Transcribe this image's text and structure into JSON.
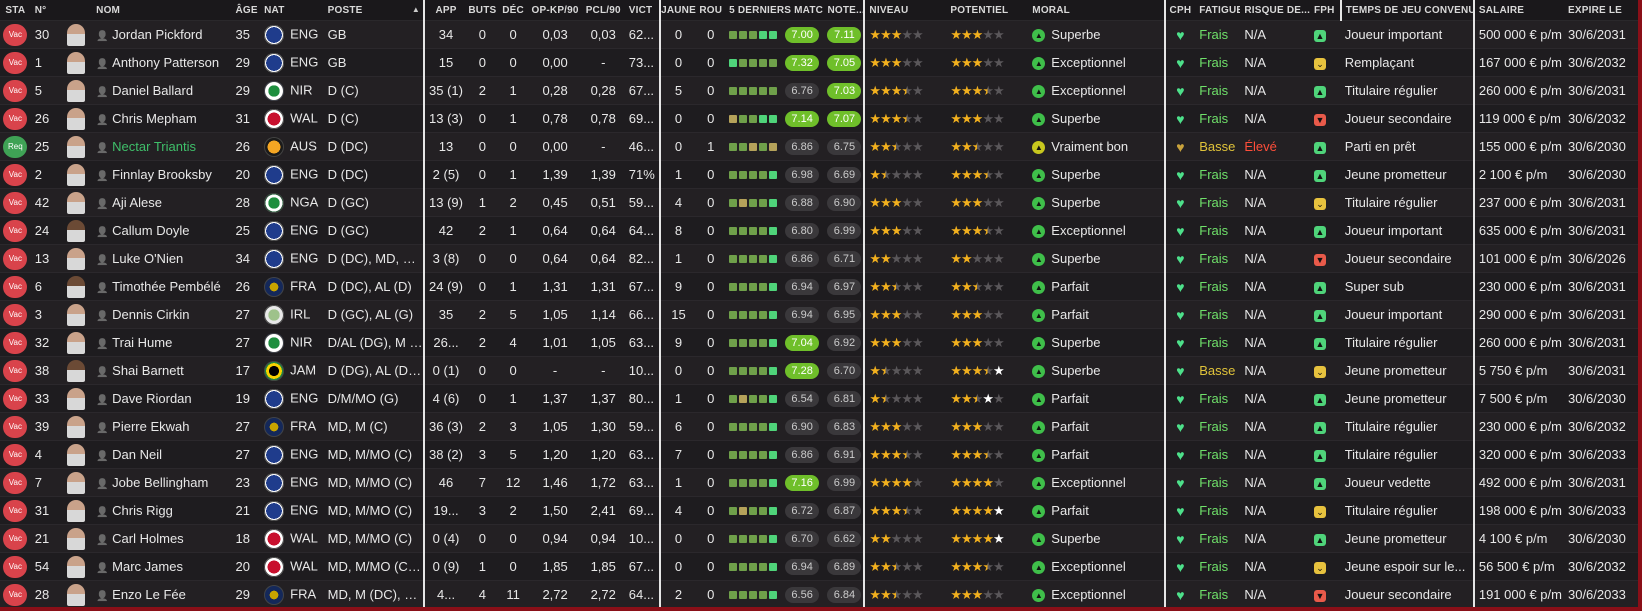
{
  "columns": [
    {
      "key": "sta",
      "label": "STA"
    },
    {
      "key": "num",
      "label": "N°"
    },
    {
      "key": "photo",
      "label": ""
    },
    {
      "key": "name",
      "label": "NOM"
    },
    {
      "key": "age",
      "label": "ÂGE"
    },
    {
      "key": "nat",
      "label": "NAT"
    },
    {
      "key": "pos",
      "label": "POSTE"
    },
    {
      "key": "app",
      "label": "APP"
    },
    {
      "key": "buts",
      "label": "BUTS"
    },
    {
      "key": "dec",
      "label": "DÉC"
    },
    {
      "key": "opkp",
      "label": "OP-KP/90"
    },
    {
      "key": "pcl",
      "label": "PCL/90"
    },
    {
      "key": "vict",
      "label": "VICT"
    },
    {
      "key": "jaune",
      "label": "JAUNE"
    },
    {
      "key": "rou",
      "label": "ROU"
    },
    {
      "key": "form",
      "label": "5 DERNIERS MATCHS"
    },
    {
      "key": "note",
      "label": "NOTE..."
    },
    {
      "key": "niveau",
      "label": "NIVEAU"
    },
    {
      "key": "potentiel",
      "label": "POTENTIEL"
    },
    {
      "key": "moral",
      "label": "MORAL"
    },
    {
      "key": "cph",
      "label": "CPH"
    },
    {
      "key": "fatigue",
      "label": "FATIGUE"
    },
    {
      "key": "risque",
      "label": "RISQUE DE..."
    },
    {
      "key": "fph",
      "label": "FPH"
    },
    {
      "key": "temps",
      "label": "TEMPS DE JEU CONVENU"
    },
    {
      "key": "salaire",
      "label": "SALAIRE"
    },
    {
      "key": "expire",
      "label": "EXPIRE LE"
    }
  ],
  "sort_indicator": "▲",
  "icons": {
    "heart": "heart-icon",
    "person": "person-icon",
    "mood": "mood-arrow-icon"
  },
  "colors": {
    "accent_red": "#8a0f18",
    "status_vac": "#d9434b",
    "status_req": "#3fa255",
    "fresh": "#6fe06a",
    "high_risk": "#ff4e3a"
  },
  "rows": [
    {
      "sta": "Vac",
      "num": "30",
      "name": "Jordan Pickford",
      "age": "35",
      "nat": "ENG",
      "pos": "GB",
      "app": "34",
      "buts": "0",
      "dec": "0",
      "opkp": "0,03",
      "pcl": "0,03",
      "vict": "62...",
      "jaune": "0",
      "rou": "0",
      "form": [
        "fg",
        "fg",
        "fg",
        "fb",
        "fb"
      ],
      "r1": "7.00",
      "r1hi": true,
      "r2": "7.11",
      "r2hi": true,
      "niv": [
        3,
        0,
        0
      ],
      "pot": [
        3,
        0,
        0
      ],
      "moral": "Superbe",
      "cph": "g",
      "fatigue": "Frais",
      "fat": "fresh",
      "risque": "N/A",
      "fph": "g",
      "temps": "Joueur important",
      "salaire": "500 000 € p/m",
      "expire": "30/6/2031"
    },
    {
      "sta": "Vac",
      "num": "1",
      "name": "Anthony Patterson",
      "age": "29",
      "nat": "ENG",
      "pos": "GB",
      "app": "15",
      "buts": "0",
      "dec": "0",
      "opkp": "0,00",
      "pcl": "-",
      "vict": "73...",
      "jaune": "0",
      "rou": "0",
      "form": [
        "fb",
        "fg",
        "fg",
        "fg",
        "fg"
      ],
      "r1": "7.32",
      "r1hi": true,
      "r2": "7.05",
      "r2hi": true,
      "niv": [
        3,
        0,
        0
      ],
      "pot": [
        3,
        0,
        0
      ],
      "moral": "Exceptionnel",
      "cph": "g",
      "fatigue": "Frais",
      "fat": "fresh",
      "risque": "N/A",
      "fph": "y",
      "temps": "Remplaçant",
      "salaire": "167 000 € p/m",
      "expire": "30/6/2032"
    },
    {
      "sta": "Vac",
      "num": "5",
      "name": "Daniel Ballard",
      "age": "29",
      "nat": "NIR",
      "pos": "D (C)",
      "app": "35 (1)",
      "buts": "2",
      "dec": "1",
      "opkp": "0,28",
      "pcl": "0,28",
      "vict": "67...",
      "jaune": "5",
      "rou": "0",
      "form": [
        "fg",
        "fg",
        "fg",
        "fg",
        "fg"
      ],
      "r1": "6.76",
      "r1hi": false,
      "r2": "7.03",
      "r2hi": true,
      "niv": [
        3,
        1,
        0
      ],
      "pot": [
        3,
        1,
        0
      ],
      "moral": "Exceptionnel",
      "cph": "g",
      "fatigue": "Frais",
      "fat": "fresh",
      "risque": "N/A",
      "fph": "g",
      "temps": "Titulaire régulier",
      "salaire": "260 000 € p/m",
      "expire": "30/6/2031"
    },
    {
      "sta": "Vac",
      "num": "26",
      "name": "Chris Mepham",
      "age": "31",
      "nat": "WAL",
      "pos": "D (C)",
      "app": "13 (3)",
      "buts": "0",
      "dec": "1",
      "opkp": "0,78",
      "pcl": "0,78",
      "vict": "69...",
      "jaune": "0",
      "rou": "0",
      "form": [
        "fy",
        "fg",
        "fg",
        "fb",
        "fb"
      ],
      "r1": "7.14",
      "r1hi": true,
      "r2": "7.07",
      "r2hi": true,
      "niv": [
        3,
        1,
        0
      ],
      "pot": [
        3,
        0,
        0
      ],
      "moral": "Superbe",
      "cph": "g",
      "fatigue": "Frais",
      "fat": "fresh",
      "risque": "N/A",
      "fph": "r",
      "temps": "Joueur secondaire",
      "salaire": "119 000 € p/m",
      "expire": "30/6/2032"
    },
    {
      "sta": "Req",
      "num": "25",
      "name": "Nectar Triantis",
      "age": "26",
      "nat": "AUS",
      "pos": "D (DC)",
      "app": "13",
      "buts": "0",
      "dec": "0",
      "opkp": "0,00",
      "pcl": "-",
      "vict": "46...",
      "jaune": "0",
      "rou": "1",
      "form": [
        "fg",
        "fg",
        "fy",
        "fg",
        "fy"
      ],
      "r1": "6.86",
      "r1hi": false,
      "r2": "6.75",
      "r2hi": false,
      "niv": [
        2,
        1,
        0
      ],
      "pot": [
        2,
        1,
        0
      ],
      "moral": "Vraiment bon",
      "mood": "y",
      "cph": "y",
      "fatigue": "Basse",
      "fat": "low",
      "risque": "Élevé",
      "risk": "high",
      "fph": "g",
      "temps": "Parti en prêt",
      "salaire": "155 000 € p/m",
      "expire": "30/6/2030",
      "loan": true
    },
    {
      "sta": "Vac",
      "num": "2",
      "name": "Finnlay Brooksby",
      "age": "20",
      "nat": "ENG",
      "pos": "D (DC)",
      "app": "2 (5)",
      "buts": "0",
      "dec": "1",
      "opkp": "1,39",
      "pcl": "1,39",
      "vict": "71%",
      "jaune": "1",
      "rou": "0",
      "form": [
        "fg",
        "fg",
        "fg",
        "fg",
        "fb"
      ],
      "r1": "6.98",
      "r1hi": false,
      "r2": "6.69",
      "r2hi": false,
      "niv": [
        1,
        1,
        0
      ],
      "pot": [
        3,
        1,
        0
      ],
      "moral": "Superbe",
      "cph": "g",
      "fatigue": "Frais",
      "fat": "fresh",
      "risque": "N/A",
      "fph": "g",
      "temps": "Jeune prometteur",
      "salaire": "2 100 € p/m",
      "expire": "30/6/2030"
    },
    {
      "sta": "Vac",
      "num": "42",
      "name": "Aji Alese",
      "age": "28",
      "nat": "NGA",
      "pos": "D (GC)",
      "app": "13 (9)",
      "buts": "1",
      "dec": "2",
      "opkp": "0,45",
      "pcl": "0,51",
      "vict": "59...",
      "jaune": "4",
      "rou": "0",
      "form": [
        "fg",
        "fy",
        "fg",
        "fg",
        "fb"
      ],
      "r1": "6.88",
      "r1hi": false,
      "r2": "6.90",
      "r2hi": false,
      "niv": [
        3,
        0,
        0
      ],
      "pot": [
        3,
        0,
        0
      ],
      "moral": "Superbe",
      "cph": "g",
      "fatigue": "Frais",
      "fat": "fresh",
      "risque": "N/A",
      "fph": "y",
      "temps": "Titulaire régulier",
      "salaire": "237 000 € p/m",
      "expire": "30/6/2031"
    },
    {
      "sta": "Vac",
      "num": "24",
      "name": "Callum Doyle",
      "age": "25",
      "nat": "ENG",
      "pos": "D (GC)",
      "app": "42",
      "buts": "2",
      "dec": "1",
      "opkp": "0,64",
      "pcl": "0,64",
      "vict": "64...",
      "jaune": "8",
      "rou": "0",
      "form": [
        "fg",
        "fg",
        "fg",
        "fg",
        "fb"
      ],
      "r1": "6.80",
      "r1hi": false,
      "r2": "6.99",
      "r2hi": false,
      "niv": [
        3,
        0,
        0
      ],
      "pot": [
        3,
        1,
        0
      ],
      "moral": "Exceptionnel",
      "cph": "g",
      "fatigue": "Frais",
      "fat": "fresh",
      "risque": "N/A",
      "fph": "g",
      "temps": "Joueur important",
      "salaire": "635 000 € p/m",
      "expire": "30/6/2031"
    },
    {
      "sta": "Vac",
      "num": "13",
      "name": "Luke O'Nien",
      "age": "34",
      "nat": "ENG",
      "pos": "D (DC), MD, M (...",
      "app": "3 (8)",
      "buts": "0",
      "dec": "0",
      "opkp": "0,64",
      "pcl": "0,64",
      "vict": "82...",
      "jaune": "1",
      "rou": "0",
      "form": [
        "fg",
        "fg",
        "fg",
        "fg",
        "fb"
      ],
      "r1": "6.86",
      "r1hi": false,
      "r2": "6.71",
      "r2hi": false,
      "niv": [
        2,
        0,
        0
      ],
      "pot": [
        2,
        0,
        0
      ],
      "moral": "Superbe",
      "cph": "g",
      "fatigue": "Frais",
      "fat": "fresh",
      "risque": "N/A",
      "fph": "r",
      "temps": "Joueur secondaire",
      "salaire": "101 000 € p/m",
      "expire": "30/6/2026"
    },
    {
      "sta": "Vac",
      "num": "6",
      "name": "Timothée Pembélé",
      "age": "26",
      "nat": "FRA",
      "pos": "D (DC), AL (D)",
      "app": "24 (9)",
      "buts": "0",
      "dec": "1",
      "opkp": "1,31",
      "pcl": "1,31",
      "vict": "67...",
      "jaune": "9",
      "rou": "0",
      "form": [
        "fg",
        "fg",
        "fg",
        "fg",
        "fb"
      ],
      "r1": "6.94",
      "r1hi": false,
      "r2": "6.97",
      "r2hi": false,
      "niv": [
        2,
        1,
        0
      ],
      "pot": [
        2,
        1,
        0
      ],
      "moral": "Parfait",
      "cph": "g",
      "fatigue": "Frais",
      "fat": "fresh",
      "risque": "N/A",
      "fph": "g",
      "temps": "Super sub",
      "salaire": "230 000 € p/m",
      "expire": "30/6/2031"
    },
    {
      "sta": "Vac",
      "num": "3",
      "name": "Dennis Cirkin",
      "age": "27",
      "nat": "IRL",
      "pos": "D (GC), AL (G)",
      "app": "35",
      "buts": "2",
      "dec": "5",
      "opkp": "1,05",
      "pcl": "1,14",
      "vict": "66...",
      "jaune": "15",
      "rou": "0",
      "form": [
        "fg",
        "fg",
        "fg",
        "fg",
        "fb"
      ],
      "r1": "6.94",
      "r1hi": false,
      "r2": "6.95",
      "r2hi": false,
      "niv": [
        3,
        0,
        0
      ],
      "pot": [
        3,
        0,
        0
      ],
      "moral": "Parfait",
      "cph": "g",
      "fatigue": "Frais",
      "fat": "fresh",
      "risque": "N/A",
      "fph": "g",
      "temps": "Joueur important",
      "salaire": "290 000 € p/m",
      "expire": "30/6/2031"
    },
    {
      "sta": "Vac",
      "num": "32",
      "name": "Trai Hume",
      "age": "27",
      "nat": "NIR",
      "pos": "D/AL (DG), M (...",
      "app": "26...",
      "buts": "2",
      "dec": "4",
      "opkp": "1,01",
      "pcl": "1,05",
      "vict": "63...",
      "jaune": "9",
      "rou": "0",
      "form": [
        "fg",
        "fg",
        "fg",
        "fg",
        "fb"
      ],
      "r1": "7.04",
      "r1hi": true,
      "r2": "6.92",
      "r2hi": false,
      "niv": [
        3,
        0,
        0
      ],
      "pot": [
        3,
        0,
        0
      ],
      "moral": "Superbe",
      "cph": "g",
      "fatigue": "Frais",
      "fat": "fresh",
      "risque": "N/A",
      "fph": "g",
      "temps": "Titulaire régulier",
      "salaire": "260 000 € p/m",
      "expire": "30/6/2031"
    },
    {
      "sta": "Vac",
      "num": "38",
      "name": "Shai Barnett",
      "age": "17",
      "nat": "JAM",
      "pos": "D (DG), AL (D),...",
      "app": "0 (1)",
      "buts": "0",
      "dec": "0",
      "opkp": "-",
      "pcl": "-",
      "vict": "10...",
      "jaune": "0",
      "rou": "0",
      "form": [
        "fg",
        "fg",
        "fg",
        "fg",
        "fb"
      ],
      "r1": "7.28",
      "r1hi": true,
      "r2": "6.70",
      "r2hi": false,
      "niv": [
        1,
        1,
        0
      ],
      "pot": [
        3,
        1,
        1
      ],
      "moral": "Superbe",
      "cph": "g",
      "fatigue": "Basse",
      "fat": "low",
      "risque": "N/A",
      "fph": "y",
      "temps": "Jeune prometteur",
      "salaire": "5 750 € p/m",
      "expire": "30/6/2031"
    },
    {
      "sta": "Vac",
      "num": "33",
      "name": "Dave Riordan",
      "age": "19",
      "nat": "ENG",
      "pos": "D/M/MO (G)",
      "app": "4 (6)",
      "buts": "0",
      "dec": "1",
      "opkp": "1,37",
      "pcl": "1,37",
      "vict": "80...",
      "jaune": "1",
      "rou": "0",
      "form": [
        "fg",
        "fy",
        "fg",
        "fg",
        "fb"
      ],
      "r1": "6.54",
      "r1hi": false,
      "r2": "6.81",
      "r2hi": false,
      "niv": [
        1,
        1,
        0
      ],
      "pot": [
        2,
        1,
        1
      ],
      "moral": "Parfait",
      "cph": "g",
      "fatigue": "Frais",
      "fat": "fresh",
      "risque": "N/A",
      "fph": "g",
      "temps": "Jeune prometteur",
      "salaire": "7 500 € p/m",
      "expire": "30/6/2030"
    },
    {
      "sta": "Vac",
      "num": "39",
      "name": "Pierre Ekwah",
      "age": "27",
      "nat": "FRA",
      "pos": "MD, M (C)",
      "app": "36 (3)",
      "buts": "2",
      "dec": "3",
      "opkp": "1,05",
      "pcl": "1,30",
      "vict": "59...",
      "jaune": "6",
      "rou": "0",
      "form": [
        "fg",
        "fg",
        "fg",
        "fg",
        "fb"
      ],
      "r1": "6.90",
      "r1hi": false,
      "r2": "6.83",
      "r2hi": false,
      "niv": [
        3,
        0,
        0
      ],
      "pot": [
        3,
        0,
        0
      ],
      "moral": "Parfait",
      "cph": "g",
      "fatigue": "Frais",
      "fat": "fresh",
      "risque": "N/A",
      "fph": "g",
      "temps": "Titulaire régulier",
      "salaire": "230 000 € p/m",
      "expire": "30/6/2032"
    },
    {
      "sta": "Vac",
      "num": "4",
      "name": "Dan Neil",
      "age": "27",
      "nat": "ENG",
      "pos": "MD, M/MO (C)",
      "app": "38 (2)",
      "buts": "3",
      "dec": "5",
      "opkp": "1,20",
      "pcl": "1,20",
      "vict": "63...",
      "jaune": "7",
      "rou": "0",
      "form": [
        "fg",
        "fg",
        "fg",
        "fg",
        "fb"
      ],
      "r1": "6.86",
      "r1hi": false,
      "r2": "6.91",
      "r2hi": false,
      "niv": [
        3,
        1,
        0
      ],
      "pot": [
        3,
        1,
        0
      ],
      "moral": "Parfait",
      "cph": "g",
      "fatigue": "Frais",
      "fat": "fresh",
      "risque": "N/A",
      "fph": "g",
      "temps": "Titulaire régulier",
      "salaire": "320 000 € p/m",
      "expire": "30/6/2033"
    },
    {
      "sta": "Vac",
      "num": "7",
      "name": "Jobe Bellingham",
      "age": "23",
      "nat": "ENG",
      "pos": "MD, M/MO (C)",
      "app": "46",
      "buts": "7",
      "dec": "12",
      "opkp": "1,46",
      "pcl": "1,72",
      "vict": "63...",
      "jaune": "1",
      "rou": "0",
      "form": [
        "fg",
        "fg",
        "fg",
        "fg",
        "fb"
      ],
      "r1": "7.16",
      "r1hi": true,
      "r2": "6.99",
      "r2hi": false,
      "niv": [
        4,
        0,
        0
      ],
      "pot": [
        4,
        0,
        0
      ],
      "moral": "Exceptionnel",
      "cph": "g",
      "fatigue": "Frais",
      "fat": "fresh",
      "risque": "N/A",
      "fph": "g",
      "temps": "Joueur vedette",
      "salaire": "492 000 € p/m",
      "expire": "30/6/2031"
    },
    {
      "sta": "Vac",
      "num": "31",
      "name": "Chris Rigg",
      "age": "21",
      "nat": "ENG",
      "pos": "MD, M/MO (C)",
      "app": "19...",
      "buts": "3",
      "dec": "2",
      "opkp": "1,50",
      "pcl": "2,41",
      "vict": "69...",
      "jaune": "4",
      "rou": "0",
      "form": [
        "fg",
        "fy",
        "fg",
        "fg",
        "fb"
      ],
      "r1": "6.72",
      "r1hi": false,
      "r2": "6.87",
      "r2hi": false,
      "niv": [
        3,
        1,
        0
      ],
      "pot": [
        4,
        0,
        1
      ],
      "moral": "Parfait",
      "cph": "g",
      "fatigue": "Frais",
      "fat": "fresh",
      "risque": "N/A",
      "fph": "y",
      "temps": "Titulaire régulier",
      "salaire": "198 000 € p/m",
      "expire": "30/6/2033"
    },
    {
      "sta": "Vac",
      "num": "21",
      "name": "Carl Holmes",
      "age": "18",
      "nat": "WAL",
      "pos": "MD, M/MO (C)",
      "app": "0 (4)",
      "buts": "0",
      "dec": "0",
      "opkp": "0,94",
      "pcl": "0,94",
      "vict": "10...",
      "jaune": "0",
      "rou": "0",
      "form": [
        "fg",
        "fg",
        "fg",
        "fg",
        "fb"
      ],
      "r1": "6.70",
      "r1hi": false,
      "r2": "6.62",
      "r2hi": false,
      "niv": [
        2,
        0,
        0
      ],
      "pot": [
        4,
        0,
        1
      ],
      "moral": "Superbe",
      "cph": "g",
      "fatigue": "Frais",
      "fat": "fresh",
      "risque": "N/A",
      "fph": "g",
      "temps": "Jeune prometteur",
      "salaire": "4 100 € p/m",
      "expire": "30/6/2030"
    },
    {
      "sta": "Vac",
      "num": "54",
      "name": "Marc James",
      "age": "20",
      "nat": "WAL",
      "pos": "MD, M/MO (C),...",
      "app": "0 (9)",
      "buts": "1",
      "dec": "0",
      "opkp": "1,85",
      "pcl": "1,85",
      "vict": "67...",
      "jaune": "0",
      "rou": "0",
      "form": [
        "fg",
        "fg",
        "fg",
        "fg",
        "fb"
      ],
      "r1": "6.94",
      "r1hi": false,
      "r2": "6.89",
      "r2hi": false,
      "niv": [
        2,
        1,
        0
      ],
      "pot": [
        3,
        1,
        0
      ],
      "moral": "Exceptionnel",
      "cph": "g",
      "fatigue": "Frais",
      "fat": "fresh",
      "risque": "N/A",
      "fph": "y",
      "temps": "Jeune espoir sur le...",
      "salaire": "56 500 € p/m",
      "expire": "30/6/2032"
    },
    {
      "sta": "Vac",
      "num": "28",
      "name": "Enzo Le Fée",
      "age": "29",
      "nat": "FRA",
      "pos": "MD, M (DC), M (...",
      "app": "4...",
      "buts": "4",
      "dec": "11",
      "opkp": "2,72",
      "pcl": "2,72",
      "vict": "64...",
      "jaune": "2",
      "rou": "0",
      "form": [
        "fg",
        "fg",
        "fg",
        "fg",
        "fb"
      ],
      "r1": "6.56",
      "r1hi": false,
      "r2": "6.84",
      "r2hi": false,
      "niv": [
        2,
        1,
        0
      ],
      "pot": [
        3,
        0,
        0
      ],
      "moral": "Exceptionnel",
      "cph": "g",
      "fatigue": "Frais",
      "fat": "fresh",
      "risque": "N/A",
      "fph": "r",
      "temps": "Joueur secondaire",
      "salaire": "191 000 € p/m",
      "expire": "30/6/2033"
    }
  ]
}
